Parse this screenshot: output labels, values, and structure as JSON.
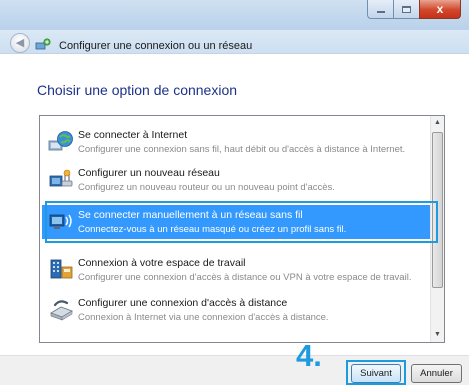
{
  "window": {
    "close_glyph": "x"
  },
  "nav": {
    "back_glyph": "◀",
    "title": "Configurer une connexion ou un réseau"
  },
  "page": {
    "heading": "Choisir une option de connexion"
  },
  "options": [
    {
      "title": "Se connecter à Internet",
      "description": "Configurer une connexion sans fil, haut débit ou d'accès à distance à Internet.",
      "icon": "globe-icon"
    },
    {
      "title": "Configurer un nouveau réseau",
      "description": "Configurez un nouveau routeur ou un nouveau point d'accès.",
      "icon": "router-icon"
    },
    {
      "title": "Se connecter manuellement à un réseau sans fil",
      "description": "Connectez-vous à un réseau masqué ou créez un profil sans fil.",
      "icon": "wireless-network-icon",
      "selected": true
    },
    {
      "title": "Connexion à votre espace de travail",
      "description": "Configurer une connexion d'accès à distance ou VPN à votre espace de travail.",
      "icon": "workplace-icon"
    },
    {
      "title": "Configurer une connexion d'accès à distance",
      "description": "Connexion à Internet via une connexion d'accès à distance.",
      "icon": "dialup-modem-icon"
    }
  ],
  "annotation": {
    "step": "4."
  },
  "buttons": {
    "next": "Suivant",
    "cancel": "Annuler"
  },
  "colors": {
    "heading": "#1e3287",
    "selection": "#3399ff",
    "annotation": "#1e9be0"
  }
}
